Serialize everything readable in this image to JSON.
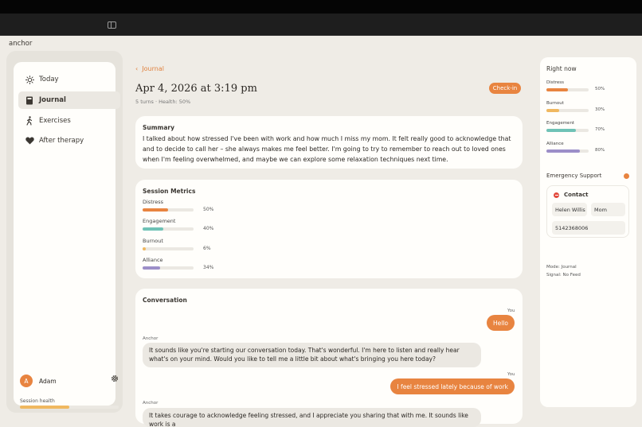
{
  "app": {
    "name": "anchor"
  },
  "icons": {
    "sidebar_toggle": "sidebar-toggle-icon"
  },
  "sidebar": {
    "items": [
      {
        "label": "Today",
        "icon": "sun-icon",
        "active": false
      },
      {
        "label": "Journal",
        "icon": "book-icon",
        "active": true
      },
      {
        "label": "Exercises",
        "icon": "walking-icon",
        "active": false
      },
      {
        "label": "After therapy",
        "icon": "heart-icon",
        "active": false
      }
    ],
    "user": {
      "initial": "A",
      "name": "Adam"
    },
    "session_health": {
      "label": "Session health",
      "level": 0.5
    }
  },
  "session": {
    "back_label": "Journal",
    "title": "Apr 4, 2026 at 3:19 pm",
    "subtitle": "5 turns · Health: 50%",
    "checkin_label": "Check-in",
    "summary_title": "Summary",
    "summary_text": "I talked about how stressed I've been with work and how much I miss my mom. It felt really good to acknowledge that and to decide to call her – she always makes me feel better. I'm going to try to remember to reach out to loved ones when I'm feeling overwhelmed, and maybe we can explore some relaxation techniques next time.",
    "metrics_title": "Session Metrics",
    "metrics": [
      {
        "label": "Distress",
        "value": "50%",
        "fraction": 0.5,
        "color": "#e88440"
      },
      {
        "label": "Engagement",
        "value": "40%",
        "fraction": 0.4,
        "color": "#6fc2b6"
      },
      {
        "label": "Burnout",
        "value": "6%",
        "fraction": 0.06,
        "color": "#f0b860"
      },
      {
        "label": "Alliance",
        "value": "34%",
        "fraction": 0.34,
        "color": "#9c8ec8"
      }
    ],
    "conversation_title": "Conversation",
    "messages": [
      {
        "speaker": "You",
        "text": "Hello"
      },
      {
        "speaker": "Anchor",
        "text": "It sounds like you're starting our conversation today. That's wonderful. I'm here to listen and really hear what's on your mind. Would you like to tell me a little bit about what's bringing you here today?"
      },
      {
        "speaker": "You",
        "text": "I feel stressed lately because of work"
      },
      {
        "speaker": "Anchor",
        "text": "It takes courage to acknowledge feeling stressed, and I appreciate you sharing that with me. It sounds like work is a"
      }
    ]
  },
  "right_panel": {
    "title": "Right now",
    "metrics": [
      {
        "label": "Distress",
        "value": "50%",
        "fraction": 0.5,
        "color": "#e88440"
      },
      {
        "label": "Burnout",
        "value": "30%",
        "fraction": 0.3,
        "color": "#f0b860"
      },
      {
        "label": "Engagement",
        "value": "70%",
        "fraction": 0.7,
        "color": "#6fc2b6"
      },
      {
        "label": "Alliance",
        "value": "80%",
        "fraction": 0.8,
        "color": "#9c8ec8"
      }
    ],
    "emergency_title": "Emergency Support",
    "contact": {
      "header": "Contact",
      "name": "Helen Willis",
      "relation": "Mom",
      "phone": "5142368006"
    },
    "mode": "Mode: Journal",
    "signal": "Signal: No Feed"
  },
  "colors": {
    "accent": "#e88440",
    "background": "#efece6",
    "card": "#fffefb"
  }
}
